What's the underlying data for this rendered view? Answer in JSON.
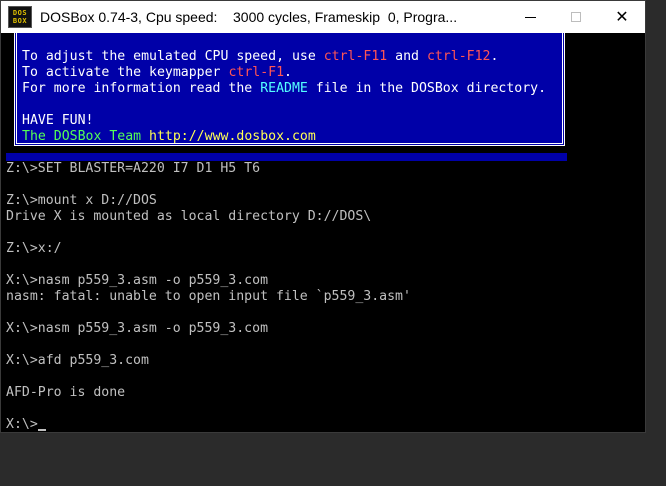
{
  "window": {
    "title": "DOSBox 0.74-3, Cpu speed:    3000 cycles, Frameskip  0, Progra...",
    "icon_text_top": "DOS",
    "icon_text_bottom": "BOX",
    "controls": {
      "minimize": "minimize-icon",
      "maximize": "maximize-icon",
      "close": "✕"
    }
  },
  "welcome": {
    "line1_a": "To adjust the emulated CPU speed, use ",
    "line1_b": "ctrl-F11",
    "line1_c": " and ",
    "line1_d": "ctrl-F12",
    "line1_e": ".",
    "line2_a": "To activate the keymapper ",
    "line2_b": "ctrl-F1",
    "line2_c": ".",
    "line3_a": "For more information read the ",
    "line3_b": "README",
    "line3_c": " file in the DOSBox directory.",
    "line4": "HAVE FUN!",
    "line5_a": "The DOSBox Team ",
    "line5_b": "http://www.dosbox.com"
  },
  "terminal": {
    "lines": [
      "Z:\\>SET BLASTER=A220 I7 D1 H5 T6",
      "",
      "Z:\\>mount x D://DOS",
      "Drive X is mounted as local directory D://DOS\\",
      "",
      "Z:\\>x:/",
      "",
      "X:\\>nasm p559_3.asm -o p559_3.com",
      "nasm: fatal: unable to open input file `p559_3.asm'",
      "",
      "X:\\>nasm p559_3.asm -o p559_3.com",
      "",
      "X:\\>afd p559_3.com",
      "",
      "AFD-Pro is done",
      "",
      "X:\\>"
    ]
  },
  "colors": {
    "welcome_bg": "#0000a8",
    "highlight_red": "#ff5555",
    "highlight_cyan": "#55ffff",
    "highlight_green": "#55ff55",
    "text_grey": "#c0c0c0"
  }
}
